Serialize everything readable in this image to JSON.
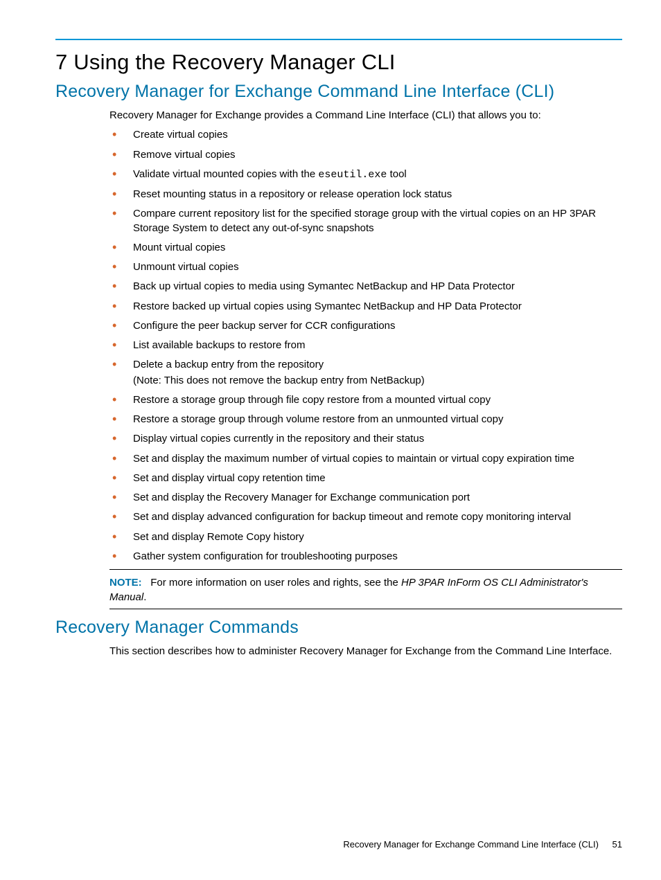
{
  "chapter": {
    "number": "7",
    "title": "Using the Recovery Manager CLI"
  },
  "section1": {
    "title": "Recovery Manager for Exchange Command Line Interface (CLI)",
    "intro": "Recovery Manager for Exchange provides a Command Line Interface (CLI) that allows you to:",
    "bullets": [
      {
        "text": "Create virtual copies"
      },
      {
        "text": "Remove virtual copies"
      },
      {
        "pre": "Validate virtual mounted copies with the ",
        "code": "eseutil.exe",
        "post": " tool"
      },
      {
        "text": "Reset mounting status in a repository or release operation lock status"
      },
      {
        "text": "Compare current repository list for the specified storage group with the virtual copies on an HP 3PAR Storage System to detect any out-of-sync snapshots"
      },
      {
        "text": "Mount virtual copies"
      },
      {
        "text": "Unmount virtual copies"
      },
      {
        "text": "Back up virtual copies to media using Symantec NetBackup and HP Data Protector"
      },
      {
        "text": "Restore backed up virtual copies using Symantec NetBackup and HP Data Protector"
      },
      {
        "text": "Configure the peer backup server for CCR configurations"
      },
      {
        "text": "List available backups to restore from"
      },
      {
        "text": "Delete a backup entry from the repository",
        "note": "(Note: This does not remove the backup entry from NetBackup)"
      },
      {
        "text": "Restore a storage group through file copy restore from a mounted virtual copy"
      },
      {
        "text": "Restore a storage group through volume restore from an unmounted virtual copy"
      },
      {
        "text": "Display virtual copies currently in the repository and their status"
      },
      {
        "text": "Set and display the maximum number of virtual copies to maintain or virtual copy expiration time"
      },
      {
        "text": "Set and display virtual copy retention time"
      },
      {
        "text": "Set and display the Recovery Manager for Exchange communication port"
      },
      {
        "text": "Set and display advanced configuration for backup timeout and remote copy monitoring interval"
      },
      {
        "text": "Set and display Remote Copy history"
      },
      {
        "text": "Gather system configuration for troubleshooting purposes"
      }
    ],
    "noteLabel": "NOTE:",
    "notePre": "For more information on user roles and rights, see the ",
    "noteItalic": "HP 3PAR InForm OS CLI Administrator's Manual",
    "notePost": "."
  },
  "section2": {
    "title": "Recovery Manager Commands",
    "body": "This section describes how to administer Recovery Manager for Exchange from the Command Line Interface."
  },
  "footer": {
    "text": "Recovery Manager for Exchange Command Line Interface (CLI)",
    "page": "51"
  }
}
